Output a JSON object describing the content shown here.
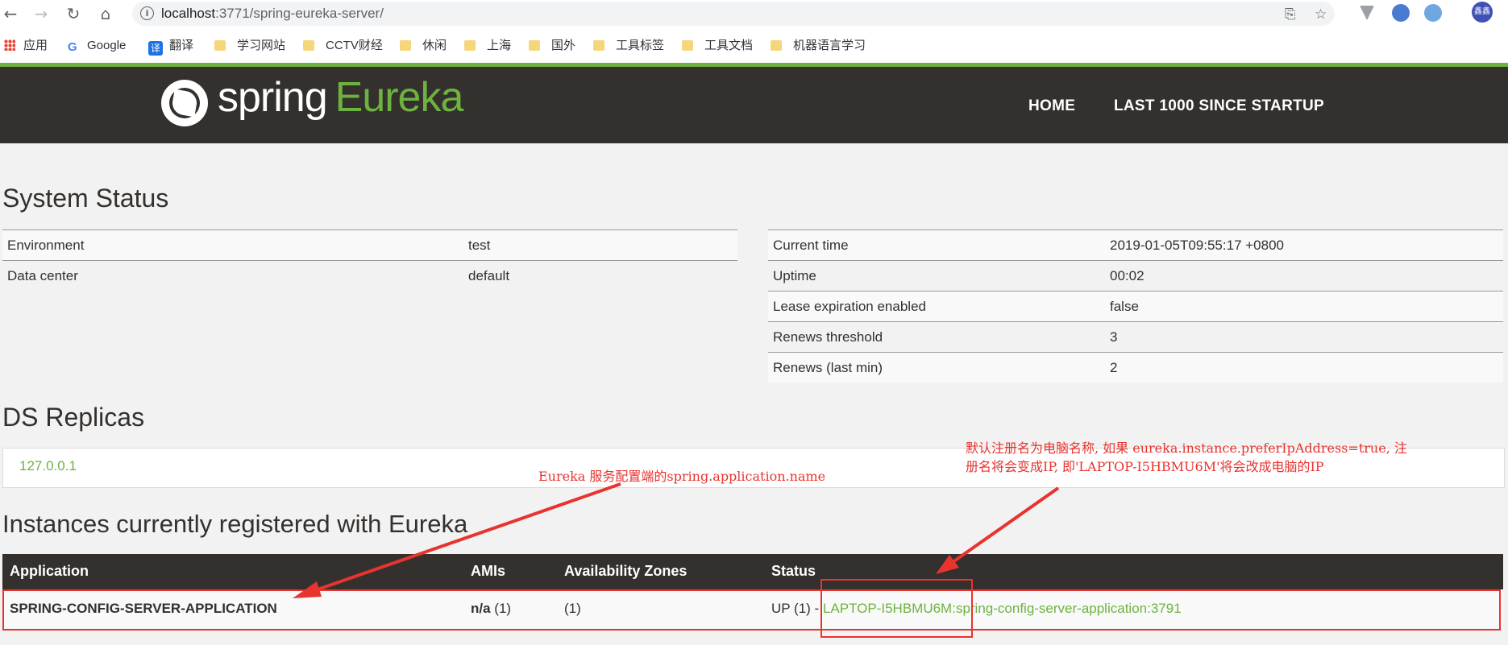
{
  "browser": {
    "url_host": "localhost",
    "url_path": ":3771/spring-eureka-server/",
    "bookmarks": [
      "应用",
      "Google",
      "翻译",
      "学习网站",
      "CCTV财经",
      "休闲",
      "上海",
      "国外",
      "工具标签",
      "工具文档",
      "机器语言学习"
    ],
    "profile_label": "鑫鑫"
  },
  "header": {
    "logo_spring": "spring",
    "logo_eureka": "Eureka",
    "nav_home": "HOME",
    "nav_last": "LAST 1000 SINCE STARTUP"
  },
  "system_status": {
    "title": "System Status",
    "left": [
      {
        "label": "Environment",
        "value": "test"
      },
      {
        "label": "Data center",
        "value": "default"
      }
    ],
    "right": [
      {
        "label": "Current time",
        "value": "2019-01-05T09:55:17 +0800"
      },
      {
        "label": "Uptime",
        "value": "00:02"
      },
      {
        "label": "Lease expiration enabled",
        "value": "false"
      },
      {
        "label": "Renews threshold",
        "value": "3"
      },
      {
        "label": "Renews (last min)",
        "value": "2"
      }
    ]
  },
  "ds_replicas": {
    "title": "DS Replicas",
    "replica": "127.0.0.1"
  },
  "instances": {
    "title": "Instances currently registered with Eureka",
    "columns": [
      "Application",
      "AMIs",
      "Availability Zones",
      "Status"
    ],
    "row": {
      "application": "SPRING-CONFIG-SERVER-APPLICATION",
      "amis_bold": "n/a",
      "amis_count": "(1)",
      "zones": "(1)",
      "status_prefix": "UP (1) -",
      "status_host": "LAPTOP-I5HBMU6M",
      "status_rest": ":spring-config-server-application:3791"
    }
  },
  "annotations": {
    "left_note": "Eureka 服务配置端的spring.application.name",
    "right_note_line1": "默认注册名为电脑名称, 如果 eureka.instance.preferIpAddress=true, 注",
    "right_note_line2": "册名将会变成IP, 即'LAPTOP-I5HBMU6M'将会改成电脑的IP",
    "color": "#e8332f"
  }
}
